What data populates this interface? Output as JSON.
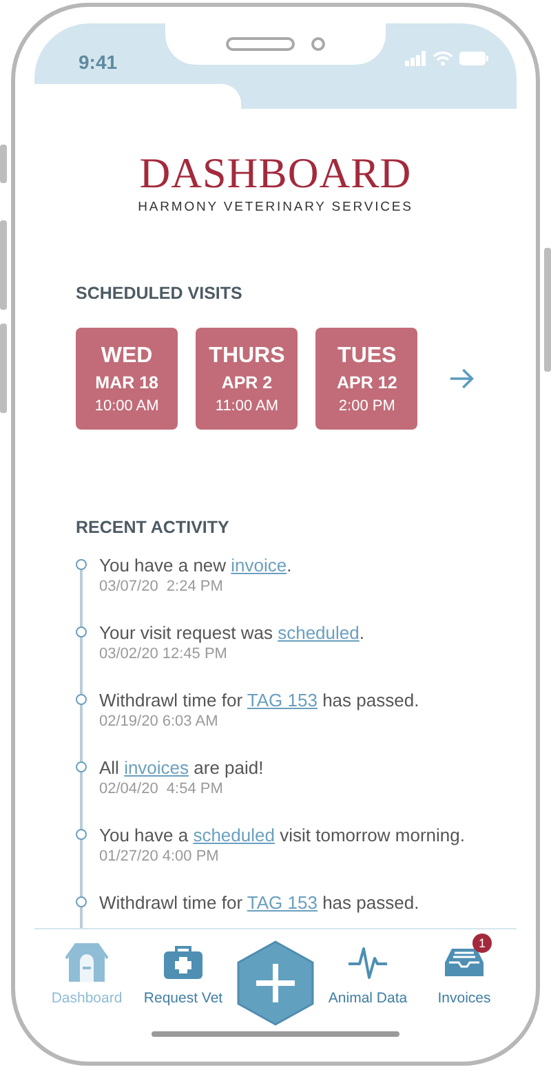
{
  "status_bar": {
    "time": "9:41"
  },
  "header": {
    "title": "DASHBOARD",
    "subtitle": "HARMONY VETERINARY SERVICES"
  },
  "scheduled_visits": {
    "heading": "SCHEDULED VISITS",
    "visits": [
      {
        "day": "WED",
        "date": "MAR 18",
        "time": "10:00 AM"
      },
      {
        "day": "THURS",
        "date": "APR 2",
        "time": "11:00 AM"
      },
      {
        "day": "TUES",
        "date": "APR 12",
        "time": "2:00 PM"
      }
    ]
  },
  "recent_activity": {
    "heading": "RECENT ACTIVITY",
    "items": [
      {
        "before": "You have a new ",
        "link": "invoice",
        "after": ".",
        "timestamp": "03/07/20  2:24 PM"
      },
      {
        "before": "Your visit request was ",
        "link": "scheduled",
        "after": ".",
        "timestamp": "03/02/20 12:45 PM"
      },
      {
        "before": "Withdrawl time for ",
        "link": "TAG 153",
        "after": " has passed.",
        "timestamp": "02/19/20 6:03 AM"
      },
      {
        "before": "All ",
        "link": "invoices",
        "after": " are paid!",
        "timestamp": "02/04/20  4:54 PM"
      },
      {
        "before": "You have a ",
        "link": "scheduled",
        "after": " visit tomorrow morning.",
        "timestamp": "01/27/20 4:00 PM"
      },
      {
        "before": "Withdrawl time for ",
        "link": "TAG 153",
        "after": " has passed."
      }
    ]
  },
  "tab_bar": [
    {
      "kind": "tab",
      "label": "Dashboard",
      "selected": true
    },
    {
      "kind": "tab",
      "label": "Request Vet",
      "selected": false
    },
    {
      "kind": "action"
    },
    {
      "kind": "tab",
      "label": "Animal Data",
      "selected": false
    },
    {
      "kind": "tab",
      "label": "Invoices",
      "selected": false,
      "badge": "1"
    }
  ]
}
